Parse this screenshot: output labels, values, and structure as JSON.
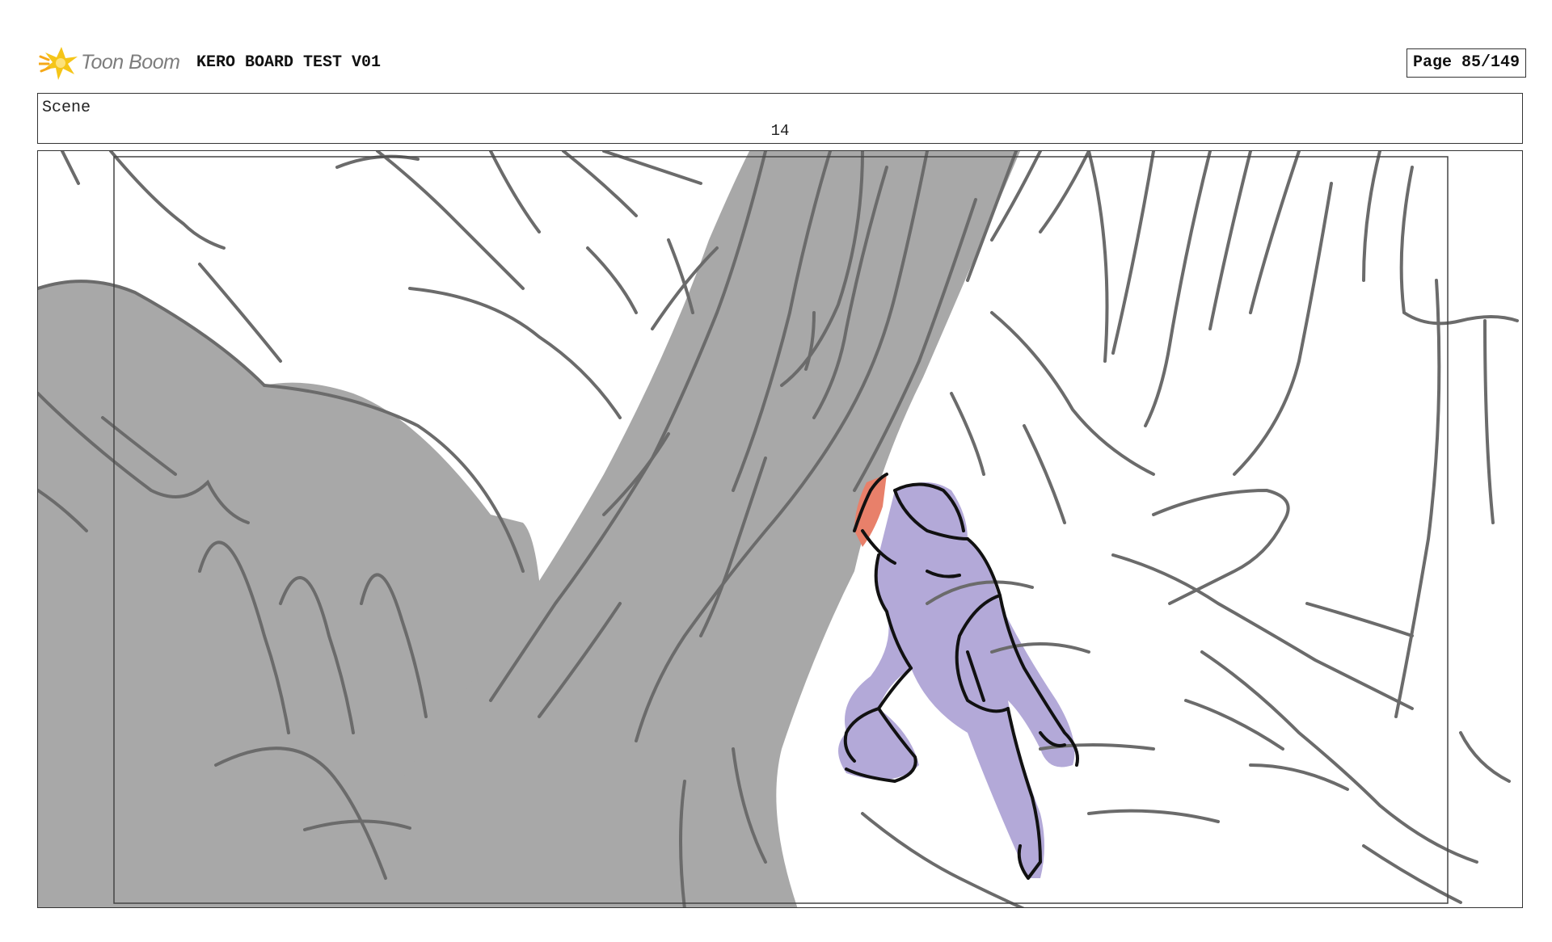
{
  "header": {
    "logo_text": "Toon Boom",
    "project_title": "KERO BOARD TEST V01",
    "page_label": "Page",
    "page_value": "85/149"
  },
  "scene": {
    "label": "Scene",
    "number": "14"
  },
  "icons": {
    "logo": "toon-boom-star-logo"
  },
  "colors": {
    "tree_fill": "#a8a8a8",
    "sketch_line": "#6b6b6b",
    "character_fill": "#b3a9d8",
    "accent_fill": "#e8806a",
    "ink": "#111111",
    "logo_yellow": "#f5c518"
  }
}
